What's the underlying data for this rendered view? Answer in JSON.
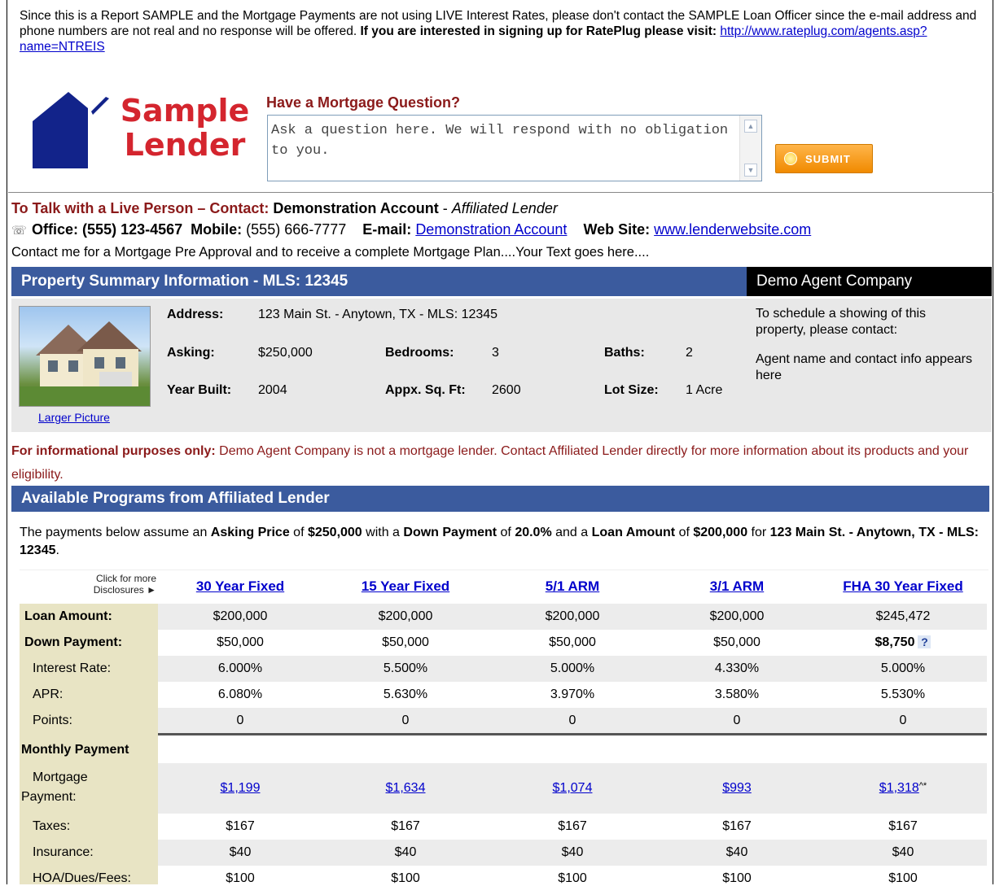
{
  "notice": {
    "text": "Since this is a Report SAMPLE and the Mortgage Payments are not using LIVE Interest Rates, please don't contact the SAMPLE Loan Officer since the e-mail address and phone numbers are not real and no response will be offered. ",
    "bold": "If you are interested in signing up for RatePlug please visit:",
    "link": "http://www.rateplug.com/agents.asp?name=NTREIS"
  },
  "logo": {
    "line1": "Sample",
    "line2": "Lender"
  },
  "question": {
    "title": "Have a Mortgage Question?",
    "placeholder": "Ask a question here. We will respond with no obligation to you.",
    "submit": "SUBMIT"
  },
  "contact": {
    "heading": "To Talk with a Live Person – Contact:",
    "name": "Demonstration Account",
    "dash": " - ",
    "role": "Affiliated Lender",
    "office_label": "Office:",
    "office": "(555) 123-4567",
    "mobile_label": "Mobile:",
    "mobile": "(555) 666-7777",
    "email_label": "E-mail:",
    "email": "Demonstration Account",
    "web_label": "Web Site:",
    "web": "www.lenderwebsite.com",
    "tagline": "Contact me for a Mortgage Pre Approval and to receive a complete Mortgage Plan....Your Text goes here...."
  },
  "property": {
    "header": "Property Summary Information - MLS: 12345",
    "company": "Demo Agent Company",
    "larger_picture": "Larger Picture",
    "address_label": "Address:",
    "address": "123 Main St. - Anytown, TX - MLS: 12345",
    "asking_label": "Asking:",
    "asking": "$250,000",
    "bedrooms_label": "Bedrooms:",
    "bedrooms": "3",
    "baths_label": "Baths:",
    "baths": "2",
    "year_label": "Year Built:",
    "year": "2004",
    "sqft_label": "Appx. Sq. Ft:",
    "sqft": "2600",
    "lot_label": "Lot Size:",
    "lot": "1 Acre",
    "agent_note1": "To schedule a showing of this property, please contact:",
    "agent_note2": "Agent name and contact info appears here"
  },
  "info": {
    "bold": "For informational purposes only:",
    "text": " Demo Agent Company is not a mortgage lender. Contact Affiliated Lender directly for more information about its products and your eligibility."
  },
  "programs": {
    "header": "Available Programs from Affiliated Lender",
    "assume": {
      "t1": "The payments below assume an ",
      "b1": "Asking Price",
      "t2": " of ",
      "b2": "$250,000",
      "t3": " with a ",
      "b3": "Down Payment",
      "t4": " of ",
      "b4": "20.0%",
      "t5": " and a ",
      "b5": "Loan Amount",
      "t6": " of ",
      "b6": "$200,000",
      "t7": " for ",
      "b7": "123 Main St. - Anytown, TX - MLS: 12345",
      "t8": "."
    },
    "disclosures": "Click for more Disclosures ►",
    "columns": [
      "30 Year Fixed",
      "15 Year Fixed",
      "5/1 ARM",
      "3/1 ARM",
      "FHA 30 Year Fixed"
    ],
    "rows": {
      "loan_amount": {
        "label": "Loan Amount:",
        "values": [
          "$200,000",
          "$200,000",
          "$200,000",
          "$200,000",
          "$245,472"
        ]
      },
      "down_payment": {
        "label": "Down Payment:",
        "values": [
          "$50,000",
          "$50,000",
          "$50,000",
          "$50,000",
          "$8,750"
        ]
      },
      "interest_rate": {
        "label": "Interest Rate:",
        "values": [
          "6.000%",
          "5.500%",
          "5.000%",
          "4.330%",
          "5.000%"
        ]
      },
      "apr": {
        "label": "APR:",
        "values": [
          "6.080%",
          "5.630%",
          "3.970%",
          "3.580%",
          "5.530%"
        ]
      },
      "points": {
        "label": "Points:",
        "values": [
          "0",
          "0",
          "0",
          "0",
          "0"
        ]
      },
      "monthly_payment": {
        "label": "Monthly Payment"
      },
      "mortgage_payment": {
        "label_l1": "Mortgage",
        "label_l2": "Payment:",
        "values": [
          "$1,199",
          "$1,634",
          "$1,074",
          "$993",
          "$1,318"
        ],
        "fha_suffix": "^*"
      },
      "taxes": {
        "label": "Taxes:",
        "values": [
          "$167",
          "$167",
          "$167",
          "$167",
          "$167"
        ]
      },
      "insurance": {
        "label": "Insurance:",
        "values": [
          "$40",
          "$40",
          "$40",
          "$40",
          "$40"
        ]
      },
      "hoa": {
        "label": "HOA/Dues/Fees:",
        "values": [
          "$100",
          "$100",
          "$100",
          "$100",
          "$100"
        ]
      }
    },
    "help_icon": "?"
  },
  "colors": {
    "accent_blue": "#3b5b9e",
    "brand_red": "#d4252e",
    "dark_red": "#8b1a1a",
    "label_bg": "#e8e4c4"
  }
}
